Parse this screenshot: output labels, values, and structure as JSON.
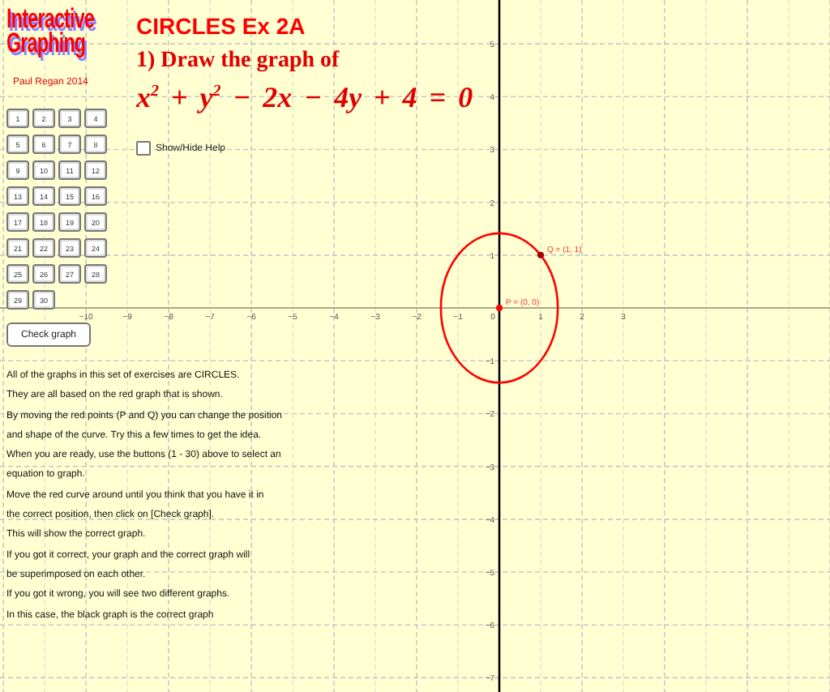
{
  "logo": "Interactive Graphing",
  "author": "Paul Regan 2014",
  "title": "CIRCLES Ex 2A",
  "question": "1) Draw the graph of",
  "equation": "x$^{2}$ + y$^{2}$ − 2x − 4y + 4 = 0",
  "equation_buttons": [
    "1",
    "2",
    "3",
    "4",
    "5",
    "6",
    "7",
    "8",
    "9",
    "10",
    "11",
    "12",
    "13",
    "14",
    "15",
    "16",
    "17",
    "18",
    "19",
    "20",
    "21",
    "22",
    "23",
    "24",
    "25",
    "26",
    "27",
    "28",
    "29",
    "30"
  ],
  "help_toggle": {
    "label": "Show/Hide Help",
    "checked": false
  },
  "check_button": "Check graph",
  "help_lines": [
    "All of the graphs in this set of exercises are CIRCLES.",
    "They are all based on the red graph that is shown.",
    "By moving the red points (P and Q) you can change the position",
    "and shape of the curve.  Try this a few times to get the idea.",
    "When you are ready, use the buttons (1 - 30) above to select an",
    "equation to graph.",
    "Move the red curve around until you think that you have it in",
    "the correct position, then click on [Check graph].",
    "This will show the correct graph.",
    "If you got it correct, your graph and the correct graph will",
    "be superimposed on each other.",
    "If you got it wrong, you will see two different graphs.",
    "In this case, the black graph is the correct graph"
  ],
  "graph": {
    "x_axis_labels": [
      "−10",
      "−9",
      "−8",
      "−7",
      "−6",
      "−5",
      "−4",
      "−3",
      "−2",
      "−1",
      "0",
      "1",
      "2",
      "3"
    ],
    "y_axis_labels": [
      "5",
      "4",
      "3",
      "2",
      "1",
      "−1",
      "−2",
      "−3",
      "−4",
      "−5",
      "−6",
      "−7"
    ],
    "points": [
      {
        "label": "P = (0, 0)"
      },
      {
        "label": "Q = (1, 1)"
      }
    ]
  }
}
